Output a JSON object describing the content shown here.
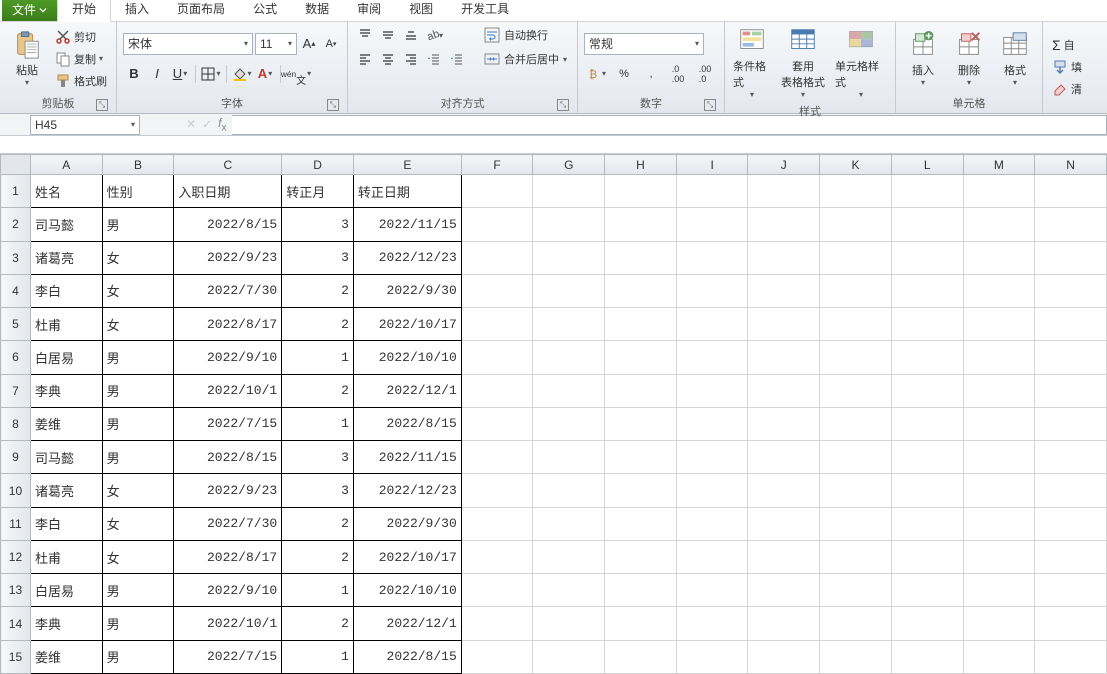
{
  "tabs": {
    "file": "文件",
    "home": "开始",
    "insert": "插入",
    "layout": "页面布局",
    "formula": "公式",
    "data": "数据",
    "review": "审阅",
    "view": "视图",
    "dev": "开发工具"
  },
  "clipboard": {
    "paste": "粘贴",
    "cut": "剪切",
    "copy": "复制",
    "format_painter": "格式刷",
    "group_label": "剪贴板"
  },
  "font": {
    "name": "宋体",
    "size": "11",
    "group_label": "字体"
  },
  "alignment": {
    "wrap": "自动换行",
    "merge": "合并后居中",
    "group_label": "对齐方式"
  },
  "number": {
    "format": "常规",
    "group_label": "数字"
  },
  "styles": {
    "cond": "条件格式",
    "table": "套用\n表格格式",
    "cell": "单元格样式",
    "group_label": "样式"
  },
  "cells": {
    "insert": "插入",
    "delete": "删除",
    "format": "格式",
    "group_label": "单元格"
  },
  "editing": {
    "sum": "自",
    "fill": "填",
    "clear": "清"
  },
  "name_box": "H45",
  "columns": [
    "A",
    "B",
    "C",
    "D",
    "E",
    "F",
    "G",
    "H",
    "I",
    "J",
    "K",
    "L",
    "M",
    "N"
  ],
  "headers": [
    "姓名",
    "性别",
    "入职日期",
    "转正月",
    "转正日期"
  ],
  "rows": [
    {
      "n": 1,
      "c": [
        "姓名",
        "性别",
        "入职日期",
        "转正月",
        "转正日期"
      ]
    },
    {
      "n": 2,
      "c": [
        "司马懿",
        "男",
        "2022/8/15",
        "3",
        "2022/11/15"
      ]
    },
    {
      "n": 3,
      "c": [
        "诸葛亮",
        "女",
        "2022/9/23",
        "3",
        "2022/12/23"
      ]
    },
    {
      "n": 4,
      "c": [
        "李白",
        "女",
        "2022/7/30",
        "2",
        "2022/9/30"
      ]
    },
    {
      "n": 5,
      "c": [
        "杜甫",
        "女",
        "2022/8/17",
        "2",
        "2022/10/17"
      ]
    },
    {
      "n": 6,
      "c": [
        "白居易",
        "男",
        "2022/9/10",
        "1",
        "2022/10/10"
      ]
    },
    {
      "n": 7,
      "c": [
        "李典",
        "男",
        "2022/10/1",
        "2",
        "2022/12/1"
      ]
    },
    {
      "n": 8,
      "c": [
        "姜维",
        "男",
        "2022/7/15",
        "1",
        "2022/8/15"
      ]
    },
    {
      "n": 9,
      "c": [
        "司马懿",
        "男",
        "2022/8/15",
        "3",
        "2022/11/15"
      ]
    },
    {
      "n": 10,
      "c": [
        "诸葛亮",
        "女",
        "2022/9/23",
        "3",
        "2022/12/23"
      ]
    },
    {
      "n": 11,
      "c": [
        "李白",
        "女",
        "2022/7/30",
        "2",
        "2022/9/30"
      ]
    },
    {
      "n": 12,
      "c": [
        "杜甫",
        "女",
        "2022/8/17",
        "2",
        "2022/10/17"
      ]
    },
    {
      "n": 13,
      "c": [
        "白居易",
        "男",
        "2022/9/10",
        "1",
        "2022/10/10"
      ]
    },
    {
      "n": 14,
      "c": [
        "李典",
        "男",
        "2022/10/1",
        "2",
        "2022/12/1"
      ]
    },
    {
      "n": 15,
      "c": [
        "姜维",
        "男",
        "2022/7/15",
        "1",
        "2022/8/15"
      ]
    }
  ]
}
